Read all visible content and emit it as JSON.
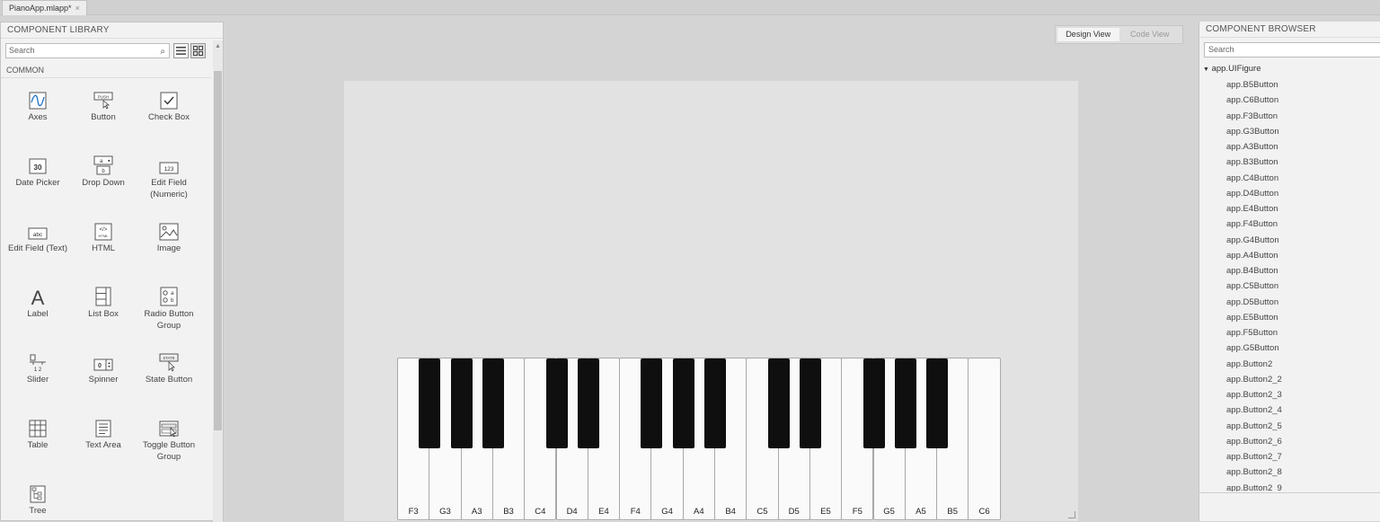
{
  "tab": {
    "title": "PianoApp.mlapp*",
    "close": "×"
  },
  "library": {
    "title": "COMPONENT LIBRARY",
    "search_placeholder": "Search",
    "section": "COMMON",
    "components": [
      {
        "label": "Axes",
        "icon": "axes-icon"
      },
      {
        "label": "Button",
        "icon": "push-button-icon"
      },
      {
        "label": "Check Box",
        "icon": "checkbox-icon"
      },
      {
        "label": "Date Picker",
        "icon": "calendar-icon"
      },
      {
        "label": "Drop Down",
        "icon": "dropdown-icon"
      },
      {
        "label": "Edit Field (Numeric)",
        "icon": "numeric-field-icon"
      },
      {
        "label": "Edit Field (Text)",
        "icon": "text-field-icon"
      },
      {
        "label": "HTML",
        "icon": "html-icon"
      },
      {
        "label": "Image",
        "icon": "image-icon"
      },
      {
        "label": "Label",
        "icon": "label-icon"
      },
      {
        "label": "List Box",
        "icon": "listbox-icon"
      },
      {
        "label": "Radio Button Group",
        "icon": "radio-group-icon"
      },
      {
        "label": "Slider",
        "icon": "slider-icon"
      },
      {
        "label": "Spinner",
        "icon": "spinner-icon"
      },
      {
        "label": "State Button",
        "icon": "state-button-icon"
      },
      {
        "label": "Table",
        "icon": "table-icon"
      },
      {
        "label": "Text Area",
        "icon": "textarea-icon"
      },
      {
        "label": "Toggle Button Group",
        "icon": "toggle-group-icon"
      },
      {
        "label": "Tree",
        "icon": "tree-icon"
      }
    ],
    "icon_text": {
      "push": "PUSH",
      "date": "30",
      "dd_a": "a",
      "dd_b": "b",
      "numeric": "123",
      "text": "abc",
      "html": "</>",
      "html_small": "HTML",
      "label": "A",
      "radio_a": "a",
      "radio_b": "b",
      "slider_ticks": "1  2",
      "spinner": "0",
      "state": "STATE"
    }
  },
  "canvas": {
    "design_view": "Design View",
    "code_view": "Code View",
    "white_keys": [
      "F3",
      "G3",
      "A3",
      "B3",
      "C4",
      "D4",
      "E4",
      "F4",
      "G4",
      "A4",
      "B4",
      "C5",
      "D5",
      "E5",
      "F5",
      "G5",
      "A5",
      "B5",
      "C6"
    ]
  },
  "browser": {
    "title": "COMPONENT BROWSER",
    "search_placeholder": "Search",
    "root": "app.UIFigure",
    "items": [
      "app.B5Button",
      "app.C6Button",
      "app.F3Button",
      "app.G3Button",
      "app.A3Button",
      "app.B3Button",
      "app.C4Button",
      "app.D4Button",
      "app.E4Button",
      "app.F4Button",
      "app.G4Button",
      "app.A4Button",
      "app.B4Button",
      "app.C5Button",
      "app.D5Button",
      "app.E5Button",
      "app.F5Button",
      "app.G5Button",
      "app.Button2",
      "app.Button2_2",
      "app.Button2_3",
      "app.Button2_4",
      "app.Button2_5",
      "app.Button2_6",
      "app.Button2_7",
      "app.Button2_8",
      "app.Button2_9"
    ]
  },
  "colors": {
    "black_key": "#0f0f0f",
    "white_key": "#fafafa",
    "figure": "#e2e2e2",
    "panel": "#f2f2f2"
  }
}
